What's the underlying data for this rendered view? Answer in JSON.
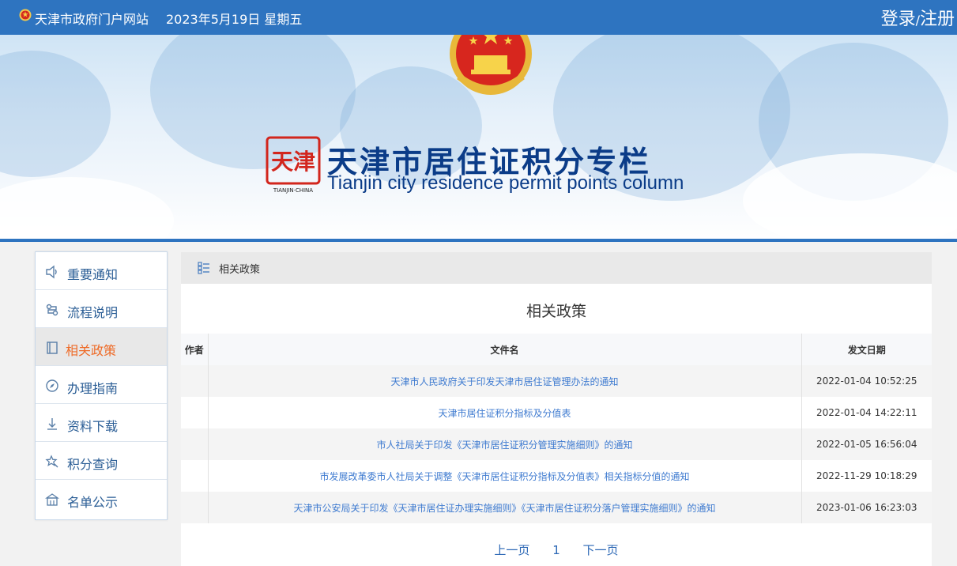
{
  "topbar": {
    "site_name": "天津市政府门户网站",
    "date": "2023年5月19日 星期五",
    "login": "登录",
    "separator": "/",
    "register": "注册"
  },
  "banner": {
    "title": "天津市居住证积分专栏",
    "subtitle": "Tianjin city residence permit points column",
    "seal_text": "天津",
    "seal_caption": "TIANJIN·CHINA"
  },
  "sidebar": {
    "items": [
      {
        "label": "重要通知",
        "icon": "speaker-icon"
      },
      {
        "label": "流程说明",
        "icon": "flow-icon"
      },
      {
        "label": "相关政策",
        "icon": "book-icon",
        "active": true
      },
      {
        "label": "办理指南",
        "icon": "compass-icon"
      },
      {
        "label": "资料下载",
        "icon": "download-icon"
      },
      {
        "label": "积分查询",
        "icon": "star-search-icon"
      },
      {
        "label": "名单公示",
        "icon": "building-icon"
      }
    ]
  },
  "main": {
    "breadcrumb": "相关政策",
    "title": "相关政策",
    "table": {
      "headers": [
        "作者",
        "文件名",
        "发文日期"
      ],
      "rows": [
        {
          "author": "",
          "name": "天津市人民政府关于印发天津市居住证管理办法的通知",
          "date": "2022-01-04 10:52:25"
        },
        {
          "author": "",
          "name": "天津市居住证积分指标及分值表",
          "date": "2022-01-04 14:22:11"
        },
        {
          "author": "",
          "name": "市人社局关于印发《天津市居住证积分管理实施细则》的通知",
          "date": "2022-01-05 16:56:04"
        },
        {
          "author": "",
          "name": "市发展改革委市人社局关于调整《天津市居住证积分指标及分值表》相关指标分值的通知",
          "date": "2022-11-29 10:18:29"
        },
        {
          "author": "",
          "name": "天津市公安局关于印发《天津市居住证办理实施细则》《天津市居住证积分落户管理实施细则》的通知",
          "date": "2023-01-06 16:23:03"
        }
      ]
    },
    "pager": {
      "prev": "上一页",
      "current": "1",
      "next": "下一页"
    }
  },
  "colors": {
    "primary": "#2e74c0",
    "active": "#ee6b28",
    "link": "#3f7bd0",
    "title": "#0b3c88"
  }
}
